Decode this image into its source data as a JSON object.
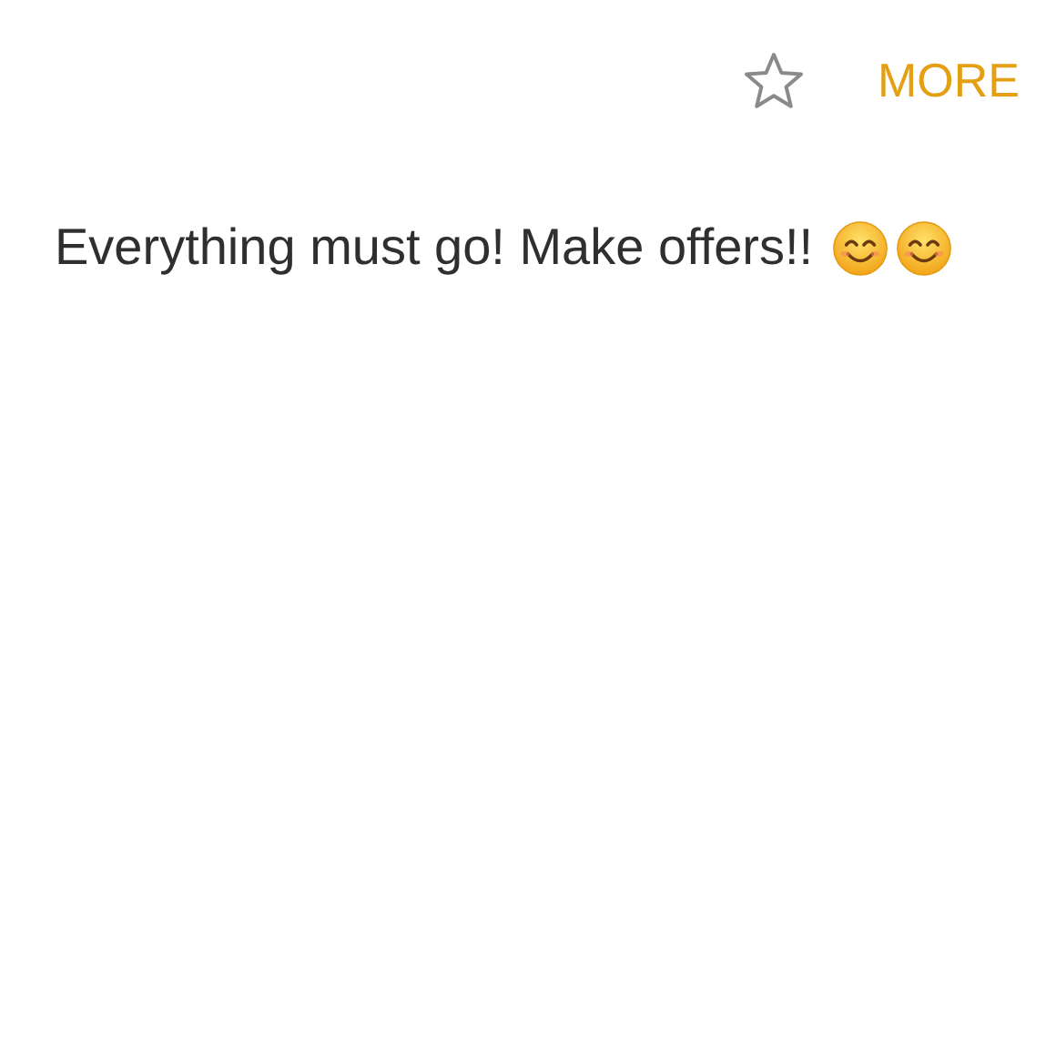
{
  "toolbar": {
    "starred": false,
    "more_label": "MORE"
  },
  "message": {
    "text": "Everything must go! Make offers!!",
    "emojis": [
      {
        "kind": "smiling"
      },
      {
        "kind": "smiling"
      }
    ]
  }
}
